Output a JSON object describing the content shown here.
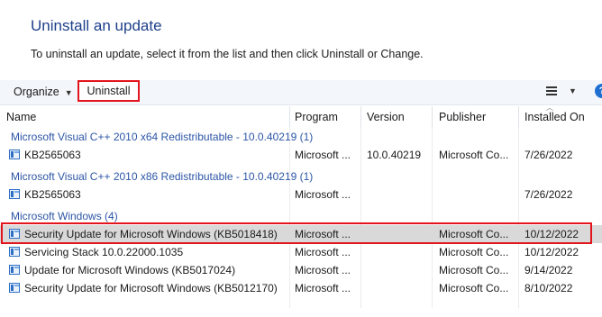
{
  "page": {
    "title": "Uninstall an update",
    "subtitle": "To uninstall an update, select it from the list and then click Uninstall or Change."
  },
  "toolbar": {
    "organize_label": "Organize",
    "uninstall_label": "Uninstall",
    "help_label": "?"
  },
  "columns": [
    "Name",
    "Program",
    "Version",
    "Publisher",
    "Installed On"
  ],
  "groups": [
    {
      "label": "Microsoft Visual C++ 2010  x64 Redistributable - 10.0.40219 (1)",
      "rows": [
        {
          "name": "KB2565063",
          "program": "Microsoft ...",
          "version": "10.0.40219",
          "publisher": "Microsoft Co...",
          "installed": "7/26/2022"
        }
      ]
    },
    {
      "label": "Microsoft Visual C++ 2010  x86 Redistributable - 10.0.40219 (1)",
      "rows": [
        {
          "name": "KB2565063",
          "program": "Microsoft ...",
          "version": "",
          "publisher": "",
          "installed": "7/26/2022"
        }
      ]
    },
    {
      "label": "Microsoft Windows (4)",
      "rows": [
        {
          "name": "Security Update for Microsoft Windows (KB5018418)",
          "program": "Microsoft ...",
          "version": "",
          "publisher": "Microsoft Co...",
          "installed": "10/12/2022",
          "selected": true
        },
        {
          "name": "Servicing Stack 10.0.22000.1035",
          "program": "Microsoft ...",
          "version": "",
          "publisher": "Microsoft Co...",
          "installed": "10/12/2022"
        },
        {
          "name": "Update for Microsoft Windows (KB5017024)",
          "program": "Microsoft ...",
          "version": "",
          "publisher": "Microsoft Co...",
          "installed": "9/14/2022"
        },
        {
          "name": "Security Update for Microsoft Windows (KB5012170)",
          "program": "Microsoft ...",
          "version": "",
          "publisher": "Microsoft Co...",
          "installed": "8/10/2022"
        }
      ]
    }
  ],
  "colors": {
    "title": "#1e3f8a",
    "group_header": "#2c56a6",
    "highlight_border": "#e2141c",
    "selected_row": "#d9d9d9"
  }
}
